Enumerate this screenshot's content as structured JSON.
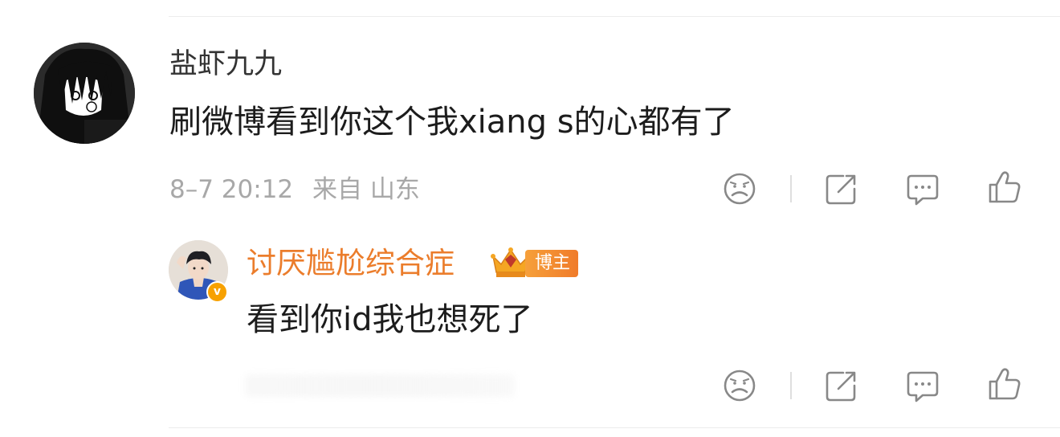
{
  "comment": {
    "username": "盐虾九九",
    "text": "刷微博看到你这个我xiang s的心都有了",
    "timestamp": "8–7 20:12",
    "location": "来自 山东"
  },
  "reply": {
    "username": "讨厌尴尬综合症",
    "badge_label": "博主",
    "verified_mark": "v",
    "text": "看到你id我也想死了"
  },
  "actions": [
    "sad-face-icon",
    "share-icon",
    "comment-icon",
    "like-icon"
  ],
  "colors": {
    "reply_username": "#eb7d2c",
    "meta_text": "#a8a8a8",
    "icon_stroke": "#888888",
    "badge_gradient_start": "#f6a03a",
    "badge_gradient_end": "#f07b2a"
  }
}
